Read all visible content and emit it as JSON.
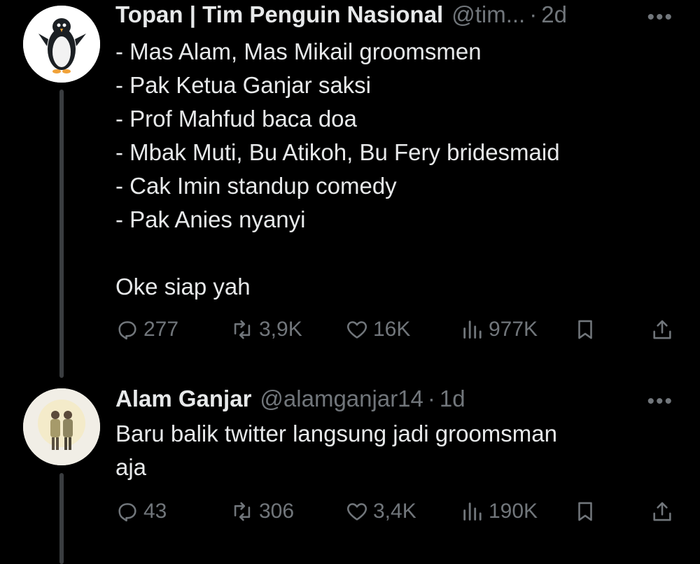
{
  "tweets": [
    {
      "name": "Topan | Tim Penguin Nasional",
      "handle": "@tim...",
      "separator": "·",
      "time": "2d",
      "more": "•••",
      "lines": [
        "- Mas Alam, Mas Mikail groomsmen",
        "- Pak Ketua Ganjar saksi",
        "- Prof Mahfud baca doa",
        "- Mbak Muti, Bu Atikoh, Bu Fery bridesmaid",
        "- Cak Imin standup comedy",
        "- Pak Anies nyanyi",
        "",
        "Oke siap yah"
      ],
      "stats": {
        "replies": "277",
        "reposts": "3,9K",
        "likes": "16K",
        "views": "977K"
      },
      "avatar_icon": "penguin-avatar-icon"
    },
    {
      "name": "Alam Ganjar",
      "handle": "@alamganjar14",
      "separator": "·",
      "time": "1d",
      "more": "•••",
      "lines": [
        "Baru balik twitter langsung jadi groomsman",
        "aja"
      ],
      "stats": {
        "replies": "43",
        "reposts": "306",
        "likes": "3,4K",
        "views": "190K"
      },
      "avatar_icon": "couple-illustration-avatar-icon"
    }
  ],
  "icons": {
    "reply": "reply-icon",
    "repost": "repost-icon",
    "like": "like-icon",
    "views": "views-icon",
    "bookmark": "bookmark-icon",
    "share": "share-icon"
  },
  "colors": {
    "background": "#000000",
    "text": "#e7e9ea",
    "muted": "#71767b",
    "thread_line": "#3a3d40"
  }
}
